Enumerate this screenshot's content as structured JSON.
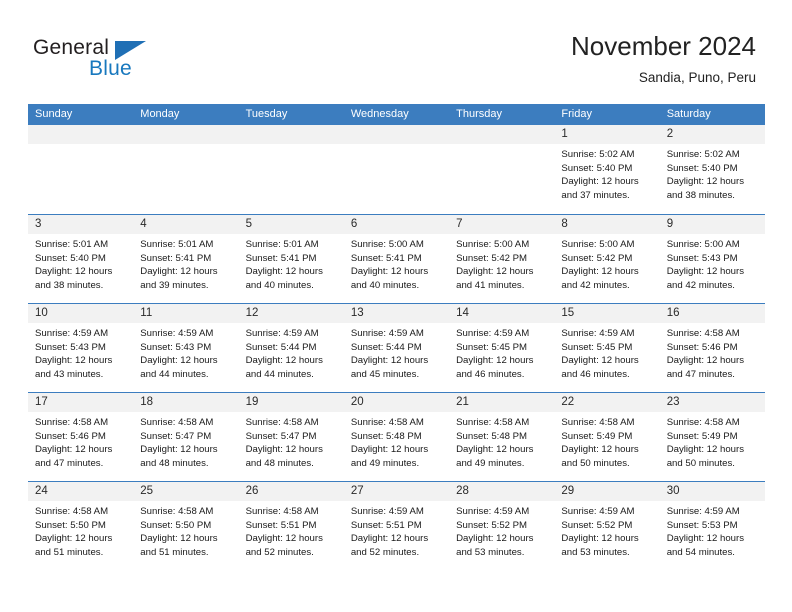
{
  "brand": {
    "name_part1": "General",
    "name_part2": "Blue",
    "color_dark": "#231f20",
    "color_blue": "#1878be"
  },
  "header": {
    "title": "November 2024",
    "subtitle": "Sandia, Puno, Peru"
  },
  "theme": {
    "header_band": "#3c7dbf",
    "day_band": "#f2f2f2",
    "row_divider": "#3c7dbf"
  },
  "day_headers": [
    "Sunday",
    "Monday",
    "Tuesday",
    "Wednesday",
    "Thursday",
    "Friday",
    "Saturday"
  ],
  "weeks": [
    [
      {
        "day": "",
        "sunrise": "",
        "sunset": "",
        "daylight1": "",
        "daylight2": ""
      },
      {
        "day": "",
        "sunrise": "",
        "sunset": "",
        "daylight1": "",
        "daylight2": ""
      },
      {
        "day": "",
        "sunrise": "",
        "sunset": "",
        "daylight1": "",
        "daylight2": ""
      },
      {
        "day": "",
        "sunrise": "",
        "sunset": "",
        "daylight1": "",
        "daylight2": ""
      },
      {
        "day": "",
        "sunrise": "",
        "sunset": "",
        "daylight1": "",
        "daylight2": ""
      },
      {
        "day": "1",
        "sunrise": "Sunrise: 5:02 AM",
        "sunset": "Sunset: 5:40 PM",
        "daylight1": "Daylight: 12 hours",
        "daylight2": "and 37 minutes."
      },
      {
        "day": "2",
        "sunrise": "Sunrise: 5:02 AM",
        "sunset": "Sunset: 5:40 PM",
        "daylight1": "Daylight: 12 hours",
        "daylight2": "and 38 minutes."
      }
    ],
    [
      {
        "day": "3",
        "sunrise": "Sunrise: 5:01 AM",
        "sunset": "Sunset: 5:40 PM",
        "daylight1": "Daylight: 12 hours",
        "daylight2": "and 38 minutes."
      },
      {
        "day": "4",
        "sunrise": "Sunrise: 5:01 AM",
        "sunset": "Sunset: 5:41 PM",
        "daylight1": "Daylight: 12 hours",
        "daylight2": "and 39 minutes."
      },
      {
        "day": "5",
        "sunrise": "Sunrise: 5:01 AM",
        "sunset": "Sunset: 5:41 PM",
        "daylight1": "Daylight: 12 hours",
        "daylight2": "and 40 minutes."
      },
      {
        "day": "6",
        "sunrise": "Sunrise: 5:00 AM",
        "sunset": "Sunset: 5:41 PM",
        "daylight1": "Daylight: 12 hours",
        "daylight2": "and 40 minutes."
      },
      {
        "day": "7",
        "sunrise": "Sunrise: 5:00 AM",
        "sunset": "Sunset: 5:42 PM",
        "daylight1": "Daylight: 12 hours",
        "daylight2": "and 41 minutes."
      },
      {
        "day": "8",
        "sunrise": "Sunrise: 5:00 AM",
        "sunset": "Sunset: 5:42 PM",
        "daylight1": "Daylight: 12 hours",
        "daylight2": "and 42 minutes."
      },
      {
        "day": "9",
        "sunrise": "Sunrise: 5:00 AM",
        "sunset": "Sunset: 5:43 PM",
        "daylight1": "Daylight: 12 hours",
        "daylight2": "and 42 minutes."
      }
    ],
    [
      {
        "day": "10",
        "sunrise": "Sunrise: 4:59 AM",
        "sunset": "Sunset: 5:43 PM",
        "daylight1": "Daylight: 12 hours",
        "daylight2": "and 43 minutes."
      },
      {
        "day": "11",
        "sunrise": "Sunrise: 4:59 AM",
        "sunset": "Sunset: 5:43 PM",
        "daylight1": "Daylight: 12 hours",
        "daylight2": "and 44 minutes."
      },
      {
        "day": "12",
        "sunrise": "Sunrise: 4:59 AM",
        "sunset": "Sunset: 5:44 PM",
        "daylight1": "Daylight: 12 hours",
        "daylight2": "and 44 minutes."
      },
      {
        "day": "13",
        "sunrise": "Sunrise: 4:59 AM",
        "sunset": "Sunset: 5:44 PM",
        "daylight1": "Daylight: 12 hours",
        "daylight2": "and 45 minutes."
      },
      {
        "day": "14",
        "sunrise": "Sunrise: 4:59 AM",
        "sunset": "Sunset: 5:45 PM",
        "daylight1": "Daylight: 12 hours",
        "daylight2": "and 46 minutes."
      },
      {
        "day": "15",
        "sunrise": "Sunrise: 4:59 AM",
        "sunset": "Sunset: 5:45 PM",
        "daylight1": "Daylight: 12 hours",
        "daylight2": "and 46 minutes."
      },
      {
        "day": "16",
        "sunrise": "Sunrise: 4:58 AM",
        "sunset": "Sunset: 5:46 PM",
        "daylight1": "Daylight: 12 hours",
        "daylight2": "and 47 minutes."
      }
    ],
    [
      {
        "day": "17",
        "sunrise": "Sunrise: 4:58 AM",
        "sunset": "Sunset: 5:46 PM",
        "daylight1": "Daylight: 12 hours",
        "daylight2": "and 47 minutes."
      },
      {
        "day": "18",
        "sunrise": "Sunrise: 4:58 AM",
        "sunset": "Sunset: 5:47 PM",
        "daylight1": "Daylight: 12 hours",
        "daylight2": "and 48 minutes."
      },
      {
        "day": "19",
        "sunrise": "Sunrise: 4:58 AM",
        "sunset": "Sunset: 5:47 PM",
        "daylight1": "Daylight: 12 hours",
        "daylight2": "and 48 minutes."
      },
      {
        "day": "20",
        "sunrise": "Sunrise: 4:58 AM",
        "sunset": "Sunset: 5:48 PM",
        "daylight1": "Daylight: 12 hours",
        "daylight2": "and 49 minutes."
      },
      {
        "day": "21",
        "sunrise": "Sunrise: 4:58 AM",
        "sunset": "Sunset: 5:48 PM",
        "daylight1": "Daylight: 12 hours",
        "daylight2": "and 49 minutes."
      },
      {
        "day": "22",
        "sunrise": "Sunrise: 4:58 AM",
        "sunset": "Sunset: 5:49 PM",
        "daylight1": "Daylight: 12 hours",
        "daylight2": "and 50 minutes."
      },
      {
        "day": "23",
        "sunrise": "Sunrise: 4:58 AM",
        "sunset": "Sunset: 5:49 PM",
        "daylight1": "Daylight: 12 hours",
        "daylight2": "and 50 minutes."
      }
    ],
    [
      {
        "day": "24",
        "sunrise": "Sunrise: 4:58 AM",
        "sunset": "Sunset: 5:50 PM",
        "daylight1": "Daylight: 12 hours",
        "daylight2": "and 51 minutes."
      },
      {
        "day": "25",
        "sunrise": "Sunrise: 4:58 AM",
        "sunset": "Sunset: 5:50 PM",
        "daylight1": "Daylight: 12 hours",
        "daylight2": "and 51 minutes."
      },
      {
        "day": "26",
        "sunrise": "Sunrise: 4:58 AM",
        "sunset": "Sunset: 5:51 PM",
        "daylight1": "Daylight: 12 hours",
        "daylight2": "and 52 minutes."
      },
      {
        "day": "27",
        "sunrise": "Sunrise: 4:59 AM",
        "sunset": "Sunset: 5:51 PM",
        "daylight1": "Daylight: 12 hours",
        "daylight2": "and 52 minutes."
      },
      {
        "day": "28",
        "sunrise": "Sunrise: 4:59 AM",
        "sunset": "Sunset: 5:52 PM",
        "daylight1": "Daylight: 12 hours",
        "daylight2": "and 53 minutes."
      },
      {
        "day": "29",
        "sunrise": "Sunrise: 4:59 AM",
        "sunset": "Sunset: 5:52 PM",
        "daylight1": "Daylight: 12 hours",
        "daylight2": "and 53 minutes."
      },
      {
        "day": "30",
        "sunrise": "Sunrise: 4:59 AM",
        "sunset": "Sunset: 5:53 PM",
        "daylight1": "Daylight: 12 hours",
        "daylight2": "and 54 minutes."
      }
    ]
  ]
}
